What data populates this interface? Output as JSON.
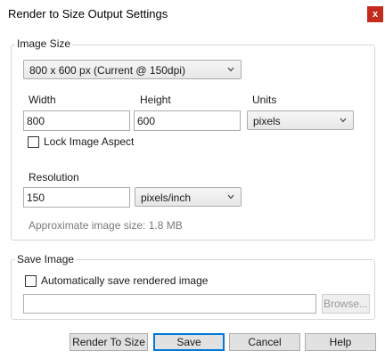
{
  "window": {
    "title": "Render to Size Output Settings",
    "close_label": "x"
  },
  "image_size": {
    "group_label": "Image Size",
    "preset": "800 x 600 px (Current @ 150dpi)",
    "width_label": "Width",
    "width_value": "800",
    "height_label": "Height",
    "height_value": "600",
    "units_label": "Units",
    "units_value": "pixels",
    "lock_aspect_label": "Lock Image Aspect",
    "lock_aspect_checked": false,
    "resolution_label": "Resolution",
    "resolution_value": "150",
    "resolution_units_value": "pixels/inch",
    "approx_size_text": "Approximate image size: 1.8 MB"
  },
  "save_image": {
    "group_label": "Save Image",
    "auto_save_label": "Automatically save rendered image",
    "auto_save_checked": false,
    "path_value": "",
    "browse_label": "Browse..."
  },
  "buttons": {
    "render_to_size": "Render To Size",
    "save": "Save",
    "cancel": "Cancel",
    "help": "Help"
  },
  "colors": {
    "accent": "#0078d7",
    "close_button": "#c42b1c"
  }
}
